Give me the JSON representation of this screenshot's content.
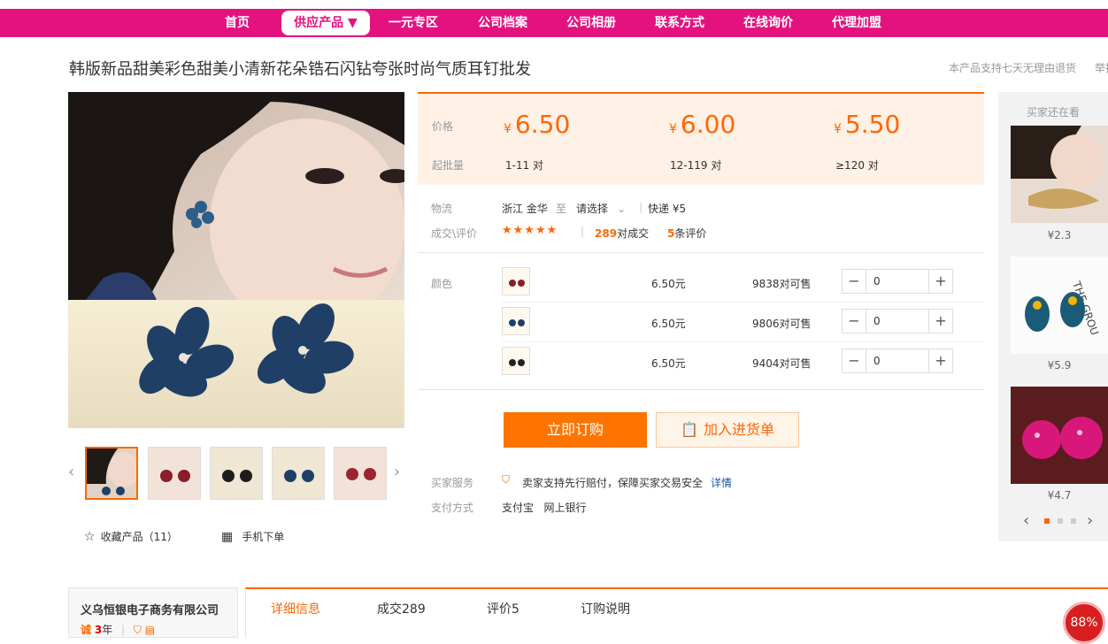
{
  "nav": {
    "items": [
      "首页",
      "供应产品 ▼",
      "一元专区",
      "公司档案",
      "公司相册",
      "联系方式",
      "在线询价",
      "代理加盟"
    ]
  },
  "product": {
    "title": "韩版新品甜美彩色甜美小清新花朵锆石闪钻夸张时尚气质耳钉批发",
    "notice": "本产品支持七天无理由退货",
    "notice2": "举报"
  },
  "pricing": {
    "price_label": "价格",
    "moq_label": "起批量",
    "currency": "¥",
    "tiers": [
      {
        "price": "6.50",
        "moq": "1-11 对"
      },
      {
        "price": "6.00",
        "moq": "12-119 对"
      },
      {
        "price": "5.50",
        "moq": "≥120 对"
      }
    ]
  },
  "logistics": {
    "label": "物流",
    "from": "浙江 金华",
    "to": "至",
    "select": "请选择",
    "express": "快递 ¥5"
  },
  "deals": {
    "label": "成交\\评价",
    "stars": "★★★★★",
    "sold_count": "289",
    "sold_label": "对成交",
    "reviews_count": "5",
    "reviews_label": "条评价"
  },
  "sku": {
    "label": "颜色",
    "rows": [
      {
        "price": "6.50元",
        "stock": "9838对可售",
        "qty": "0"
      },
      {
        "price": "6.50元",
        "stock": "9806对可售",
        "qty": "0"
      },
      {
        "price": "6.50元",
        "stock": "9404对可售",
        "qty": "0"
      }
    ]
  },
  "actions": {
    "order": "立即订购",
    "cart": "加入进货单"
  },
  "services": {
    "label": "买家服务",
    "text": "卖家支持先行赔付，保障买家交易安全",
    "link": "详情",
    "pay_label": "支付方式",
    "pay_methods": "支付宝   网上银行"
  },
  "gallery": {
    "fav": "收藏产品（11）",
    "mobile": "手机下单"
  },
  "sidebar": {
    "header": "买家还在看",
    "items": [
      {
        "price": "¥2.3"
      },
      {
        "price": "¥5.9"
      },
      {
        "price": "¥4.7"
      }
    ]
  },
  "company": {
    "name": "义乌恒银电子商务有限公司",
    "years": "3",
    "years_unit": "年"
  },
  "tabs": [
    "详细信息",
    "成交289",
    "评价5",
    "订购说明"
  ],
  "badge": "88%",
  "colors": {
    "brand": "#e4127f",
    "accent": "#ff7300"
  }
}
